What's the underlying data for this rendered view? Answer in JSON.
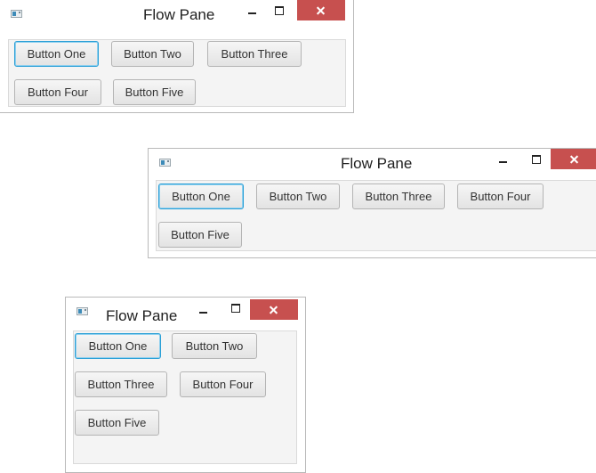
{
  "windows": [
    {
      "title": "Flow Pane",
      "buttons": [
        "Button One",
        "Button Two",
        "Button Three",
        "Button Four",
        "Button Five"
      ],
      "focused_button": "Button One"
    },
    {
      "title": "Flow Pane",
      "buttons": [
        "Button One",
        "Button Two",
        "Button Three",
        "Button Four",
        "Button Five"
      ],
      "focused_button": "Button One"
    },
    {
      "title": "Flow Pane",
      "buttons": [
        "Button One",
        "Button Two",
        "Button Three",
        "Button Four",
        "Button Five"
      ],
      "focused_button": "Button One"
    }
  ],
  "colors": {
    "close_button": "#c7504f",
    "focus_border": "#2a9fd6",
    "pane_background": "#f4f4f4"
  },
  "icons": [
    "app-icon",
    "minimize-icon",
    "maximize-icon",
    "close-icon"
  ]
}
